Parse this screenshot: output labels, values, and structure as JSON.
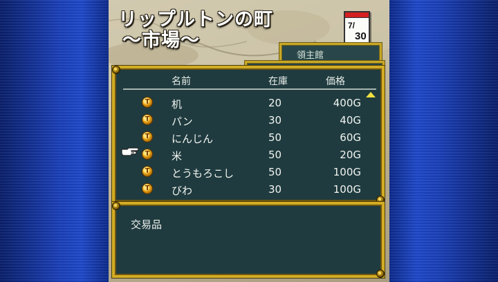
{
  "location": {
    "title": "リップルトンの町",
    "subtitle": "～市場～"
  },
  "calendar": {
    "month": "7/",
    "day": "30"
  },
  "back_window": {
    "label": "領主館"
  },
  "market": {
    "columns": {
      "name": "名前",
      "stock": "在庫",
      "price": "価格"
    },
    "items": [
      {
        "name": "机",
        "stock": "20",
        "price": "400G"
      },
      {
        "name": "パン",
        "stock": "30",
        "price": "40G"
      },
      {
        "name": "にんじん",
        "stock": "50",
        "price": "60G"
      },
      {
        "name": "米",
        "stock": "50",
        "price": "20G"
      },
      {
        "name": "とうもろこし",
        "stock": "50",
        "price": "100G"
      },
      {
        "name": "びわ",
        "stock": "30",
        "price": "100G"
      }
    ],
    "coin_glyph": "T",
    "selected_index": 3
  },
  "description": {
    "label": "交易品"
  },
  "colors": {
    "window_bg": "#1f3b3f",
    "frame_gold": "#d2ad24",
    "side_blue": "#1a3fb8"
  },
  "icons": [
    "coin-icon",
    "pointing-hand-cursor",
    "scroll-up-arrow-icon",
    "calendar-icon"
  ]
}
